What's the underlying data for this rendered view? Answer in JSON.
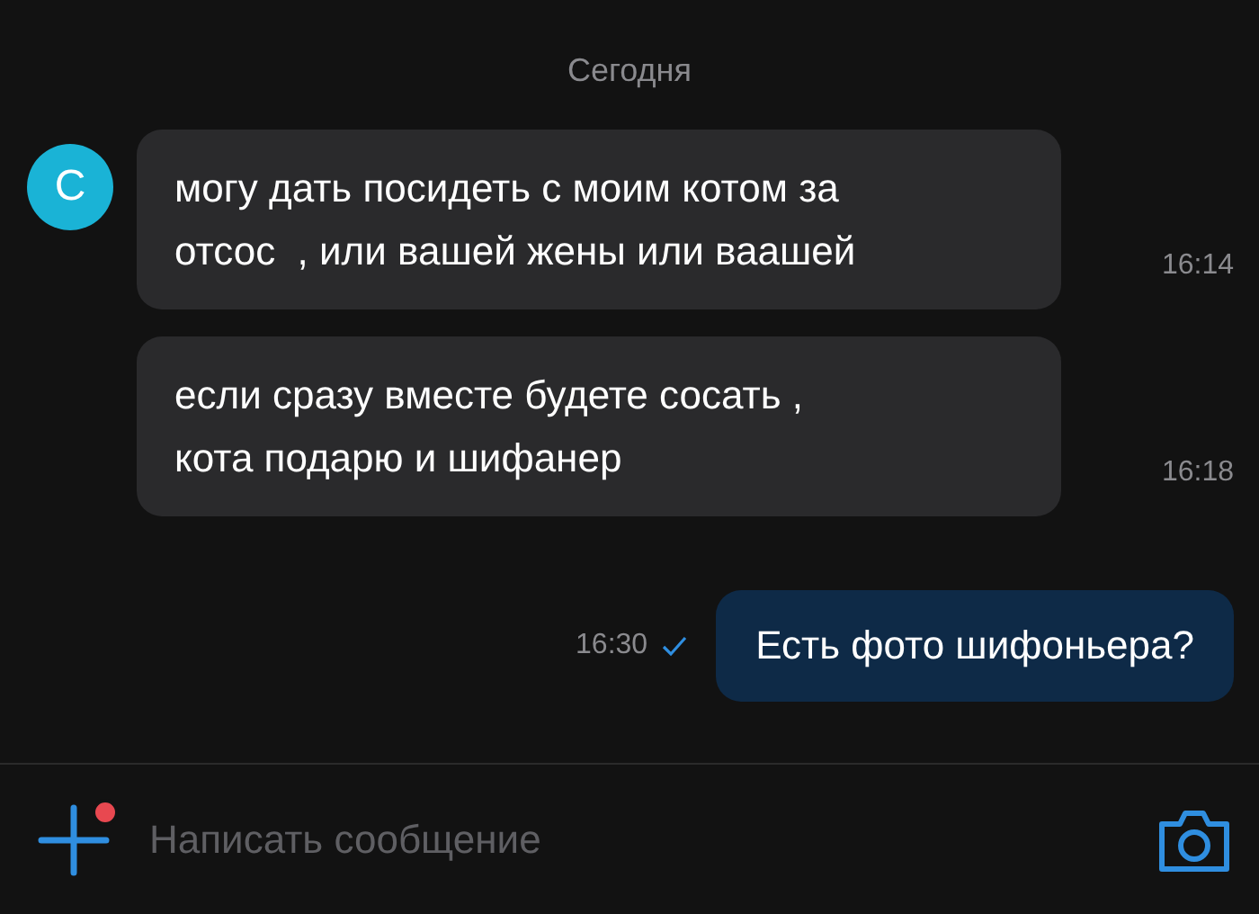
{
  "date_separator": "Сегодня",
  "messages": [
    {
      "kind": "incoming",
      "avatar": "С",
      "text": "могу дать посидеть с моим котом за\nотсос  , или вашей жены или ваашей",
      "time": "16:14"
    },
    {
      "kind": "incoming",
      "text": "если сразу вместе будете сосать ,\nкота подарю и шифанер",
      "time": "16:18"
    },
    {
      "kind": "outgoing",
      "text": "Есть фото шифоньера?",
      "time": "16:30",
      "read": true
    }
  ],
  "composer": {
    "placeholder": "Написать сообщение",
    "attachment_badge": true
  }
}
